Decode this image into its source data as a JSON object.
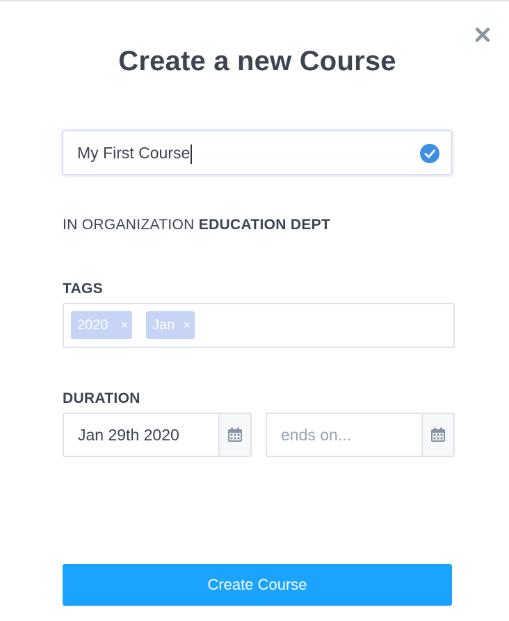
{
  "modal": {
    "title": "Create a new Course",
    "close_icon": "close-icon"
  },
  "course_name": {
    "value": "My First Course",
    "valid_icon": "check-circle-icon",
    "accent": "#3d8fe6"
  },
  "organization": {
    "prefix": "IN ORGANIZATION",
    "name": "EDUCATION DEPT"
  },
  "tags": {
    "label": "TAGS",
    "items": [
      {
        "label": "2020",
        "remove": "×"
      },
      {
        "label": "Jan",
        "remove": "×"
      }
    ],
    "tag_color": "#c6d4f5"
  },
  "duration": {
    "label": "DURATION",
    "start_value": "Jan 29th 2020",
    "end_placeholder": "ends on...",
    "calendar_icon": "calendar-icon"
  },
  "submit": {
    "label": "Create Course",
    "color": "#1aa3ff"
  }
}
